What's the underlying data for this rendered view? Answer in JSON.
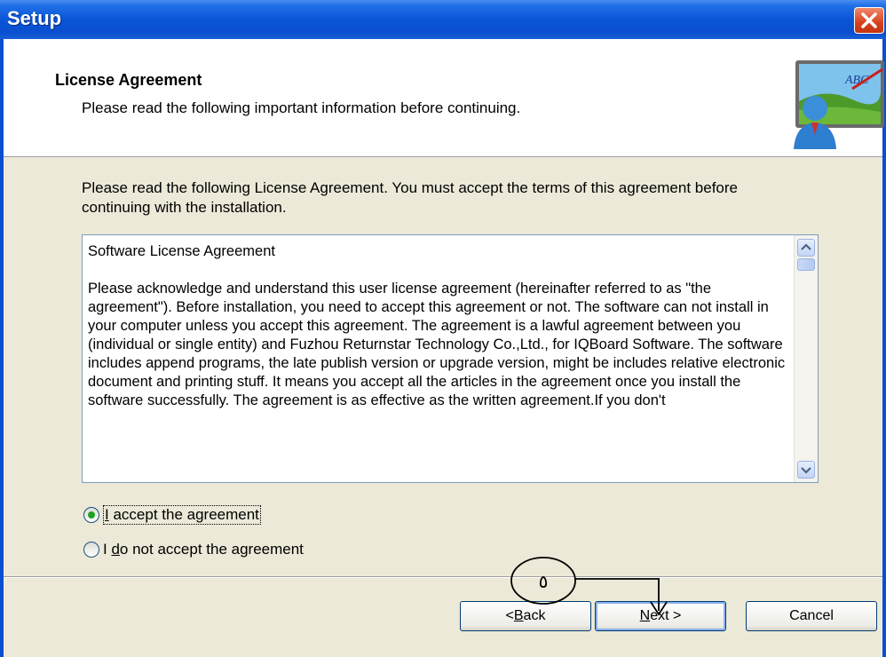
{
  "window": {
    "title": "Setup"
  },
  "header": {
    "title": "License Agreement",
    "subtitle": "Please read the following important information before continuing."
  },
  "body": {
    "intro": "Please read the following License Agreement. You must accept the terms of this agreement before continuing with the installation.",
    "license_text": "Software License Agreement\n\nPlease acknowledge and understand this user license agreement (hereinafter referred to as \"the agreement\"). Before installation, you need to accept this agreement or not. The software can not install in your computer unless you accept this agreement. The agreement is a lawful agreement between you (individual or single entity) and Fuzhou Returnstar Technology Co.,Ltd., for IQBoard Software. The software includes append programs, the late publish version or upgrade version, might be includes relative electronic document and printing stuff. It means you accept all the articles in the agreement once you install the software successfully. The agreement is as effective as the written agreement.If you don't",
    "accept_option": {
      "first": "I",
      "rest": " accept the agreement",
      "selected": true
    },
    "decline_option": {
      "pre": "I ",
      "accel": "d",
      "rest": "o not accept the agreement",
      "selected": false
    }
  },
  "buttons": {
    "back": {
      "pre": "< ",
      "accel": "B",
      "rest": "ack"
    },
    "next": {
      "accel": "N",
      "rest": "ext >"
    },
    "cancel": "Cancel"
  },
  "annotation": {
    "label": "٥"
  },
  "colors": {
    "titlebar": "#0a55d8",
    "body": "#ece9d8",
    "radio_dot": "#21a121"
  },
  "icons": [
    "close-icon",
    "scroll-up-icon",
    "scroll-down-icon",
    "setup-wizard-icon"
  ]
}
